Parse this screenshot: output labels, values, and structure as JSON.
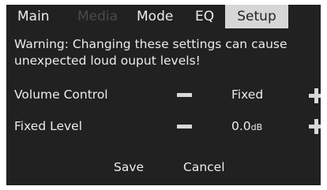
{
  "tabs": {
    "main": "Main",
    "media": "Media",
    "mode": "Mode",
    "eq": "EQ",
    "setup": "Setup"
  },
  "active_tab": "Setup",
  "warning": "Warning: Changing these settings can cause unexpected loud ouput levels!",
  "settings": {
    "volume_control": {
      "label": "Volume Control",
      "value": "Fixed"
    },
    "fixed_level": {
      "label": "Fixed Level",
      "value": "0.0",
      "unit": "dB"
    }
  },
  "buttons": {
    "save": "Save",
    "cancel": "Cancel"
  },
  "colors": {
    "screen_background": "#212121",
    "text": "#ececec",
    "disabled_text": "#4a4a4a",
    "active_tab_background": "#d6d6d6",
    "active_tab_text": "#222222",
    "icon": "#d9d9d9"
  },
  "icons": {
    "decrease": "minus-icon",
    "increase": "plus-icon"
  }
}
